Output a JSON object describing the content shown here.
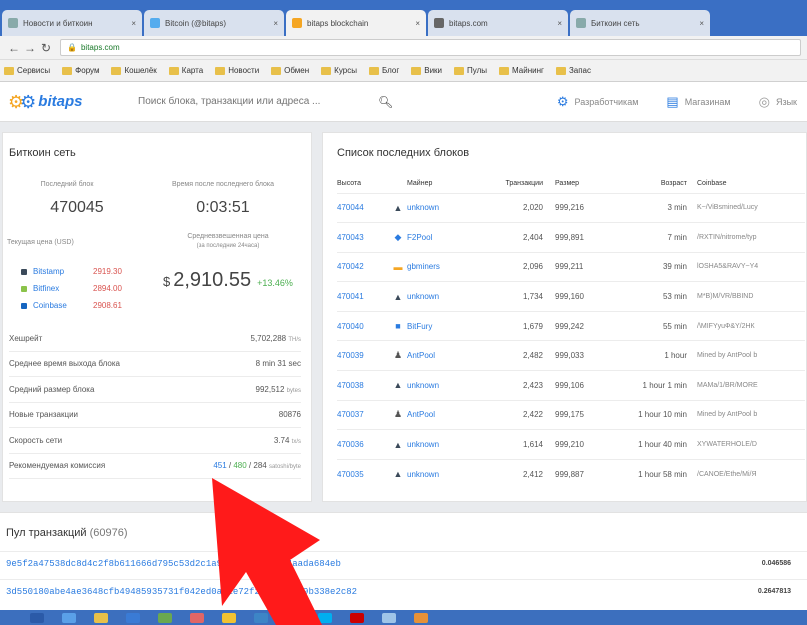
{
  "browser": {
    "tabs": [
      {
        "label": "Новости и биткоин",
        "active": false
      },
      {
        "label": "Bitcoin (@bitaps)",
        "active": false
      },
      {
        "label": "bitaps blockchain",
        "active": true
      },
      {
        "label": "bitaps.com",
        "active": false
      },
      {
        "label": "Биткоин сеть",
        "active": false
      }
    ],
    "close_glyph": "×",
    "url_secure": "bitaps.com",
    "url_rest": "",
    "bookmarks": [
      "Сервисы",
      "Форум",
      "Кошелёк",
      "Карта",
      "Новости",
      "Обмен",
      "Курсы",
      "Блог",
      "Вики",
      "Пулы",
      "Майнинг",
      "Запас"
    ]
  },
  "header": {
    "logo_text": "bitaps",
    "search_placeholder": "Поиск блока, транзакции или адреса ...",
    "links": [
      {
        "label": "Разработчикам",
        "icon": "gear-icon"
      },
      {
        "label": "Магазинам",
        "icon": "store-icon"
      },
      {
        "label": "Язык",
        "icon": "globe-icon"
      }
    ]
  },
  "network": {
    "title": "Биткоин сеть",
    "last_block_label": "Последний блок",
    "last_block": "470045",
    "time_since_label": "Время после последнего блока",
    "time_since": "0:03:51",
    "price_label": "Текущая цена (USD)",
    "weighted_label_1": "Средневзвешенная цена",
    "weighted_label_2": "(за последние 24часа)",
    "exchanges": [
      {
        "name": "Bitstamp",
        "price": "2919.30",
        "color": "#3b4a5a"
      },
      {
        "name": "Bitfinex",
        "price": "2894.00",
        "color": "#8bc34a"
      },
      {
        "name": "Coinbase",
        "price": "2908.61",
        "color": "#1565c0"
      }
    ],
    "currency_symbol": "$",
    "weighted_price": "2,910.55",
    "change": "+13.46%",
    "stats": [
      {
        "label": "Хешрейт",
        "value": "5,702,288",
        "unit": "TH/s"
      },
      {
        "label": "Среднее время выхода блока",
        "value": "8 min 31 sec",
        "unit": ""
      },
      {
        "label": "Средний размер блока",
        "value": "992,512",
        "unit": "bytes"
      },
      {
        "label": "Новые транзакции",
        "value": "80876",
        "unit": ""
      },
      {
        "label": "Скорость сети",
        "value": "3.74",
        "unit": "tx/s"
      }
    ],
    "fee": {
      "label": "Рекомендуемая комиссия",
      "a": "451",
      "sep1": " / ",
      "b": "480",
      "sep2": " / ",
      "c": "284",
      "unit": "satoshi/byte"
    }
  },
  "blocks": {
    "title": "Список последних блоков",
    "columns": [
      "Высота",
      "Майнер",
      "Транзакции",
      "Размер",
      "Возраст",
      "Coinbase"
    ],
    "rows": [
      {
        "height": "470044",
        "miner_icon": "pool-icon",
        "miner": "unknown",
        "tx": "2,020",
        "size": "999,216",
        "age": "3 min",
        "coinbase": "K~/ViBsmined/Lucy"
      },
      {
        "height": "470043",
        "miner_icon": "f2pool-icon",
        "miner": "F2Pool",
        "tx": "2,404",
        "size": "999,891",
        "age": "7 min",
        "coinbase": "/RXTIN/nitrome/typ"
      },
      {
        "height": "470042",
        "miner_icon": "btcc-icon",
        "miner": "gbminers",
        "tx": "2,096",
        "size": "999,211",
        "age": "39 min",
        "coinbase": "lOSHA5&RAVY~Y4"
      },
      {
        "height": "470041",
        "miner_icon": "pool-icon",
        "miner": "unknown",
        "tx": "1,734",
        "size": "999,160",
        "age": "53 min",
        "coinbase": "M*B)M/VR/BBIND"
      },
      {
        "height": "470040",
        "miner_icon": "bitfury-icon",
        "miner": "BitFury",
        "tx": "1,679",
        "size": "999,242",
        "age": "55 min",
        "coinbase": "/\\MIFYyuФ&Y/2НК"
      },
      {
        "height": "470039",
        "miner_icon": "antpool-icon",
        "miner": "AntPool",
        "tx": "2,482",
        "size": "999,033",
        "age": "1 hour",
        "coinbase": "Mined by AntPool b"
      },
      {
        "height": "470038",
        "miner_icon": "pool-icon",
        "miner": "unknown",
        "tx": "2,423",
        "size": "999,106",
        "age": "1 hour 1 min",
        "coinbase": "MAMa/1/BR/MORE"
      },
      {
        "height": "470037",
        "miner_icon": "antpool-icon",
        "miner": "AntPool",
        "tx": "2,422",
        "size": "999,175",
        "age": "1 hour 10 min",
        "coinbase": "Mined by AntPool b"
      },
      {
        "height": "470036",
        "miner_icon": "pool-icon",
        "miner": "unknown",
        "tx": "1,614",
        "size": "999,210",
        "age": "1 hour 40 min",
        "coinbase": "XYWATERHOLE/D"
      },
      {
        "height": "470035",
        "miner_icon": "pool-icon",
        "miner": "unknown",
        "tx": "2,412",
        "size": "999,887",
        "age": "1 hour 58 min",
        "coinbase": "/CANOE/Ethe/Mi/Я"
      }
    ]
  },
  "mempool": {
    "title": "Пул транзакций",
    "count": "(60976)",
    "rows": [
      {
        "hash": "9e5f2a47538dc8d4c2f8b611666d795c53d2c1a9807be3bbc6454aada684eb",
        "amount": "0.046586"
      },
      {
        "hash": "3d550180abe4ae3648cfb49485935731f042ed0aa1e72f27f43423b9b338e2c82",
        "amount": "0.2647813"
      }
    ]
  },
  "taskbar": {
    "icons": [
      "start-icon",
      "explorer-icon",
      "folder-icon",
      "browser-icon",
      "mail-icon",
      "media-icon",
      "chrome-icon",
      "word-icon",
      "excel-icon",
      "skype-icon",
      "opera-icon",
      "chat-icon",
      "paint-icon"
    ]
  }
}
